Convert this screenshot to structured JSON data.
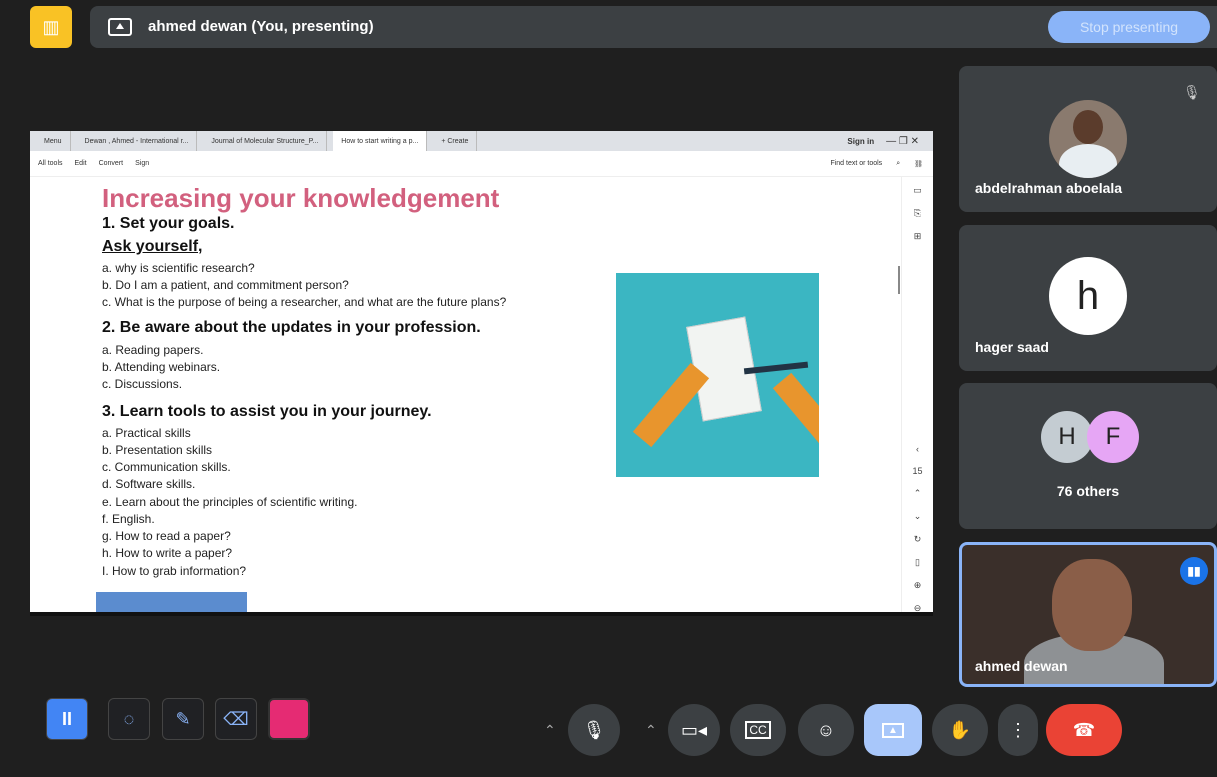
{
  "topbar": {
    "presenter": "ahmed dewan (You, presenting)",
    "stop_label": "Stop presenting"
  },
  "screen": {
    "tabs": [
      "Menu",
      "Dewan , Ahmed - International r...",
      "Journal of Molecular Structure_P...",
      "How to start writing a p...",
      "+ Create"
    ],
    "signin": "Sign in",
    "toolbar": [
      "All tools",
      "Edit",
      "Convert",
      "Sign"
    ],
    "find": "Find text or tools",
    "page_number": "15"
  },
  "doc": {
    "title": "Increasing your knowledgement",
    "s1": "1.   Set your goals.",
    "ask": "Ask yourself,",
    "a1": "a.    why is scientific research?",
    "a2": "b.    Do I am a patient, and commitment person?",
    "a3": "c.    What is the purpose of being a researcher, and what are the future plans?",
    "s2": "2. Be aware about the updates in your profession.",
    "b1": "a. Reading papers.",
    "b2": "b. Attending webinars.",
    "b3": "c. Discussions.",
    "s3": "3. Learn tools to assist you in your journey.",
    "c1": "a. Practical skills",
    "c2": "b. Presentation skills",
    "c3": "c. Communication skills.",
    "c4": "d. Software skills.",
    "c5": "e. Learn about the principles of scientific writing.",
    "c6": "f. English.",
    "c7": "g. How to read a paper?",
    "c8": "h. How to write a paper?",
    "c9": "I. How to grab information?"
  },
  "participants": {
    "p1": "abdelrahman aboelala",
    "p2": "hager saad",
    "p2_initial": "h",
    "others_initial_1": "H",
    "others_initial_2": "F",
    "others": "76 others",
    "self": "ahmed dewan"
  }
}
